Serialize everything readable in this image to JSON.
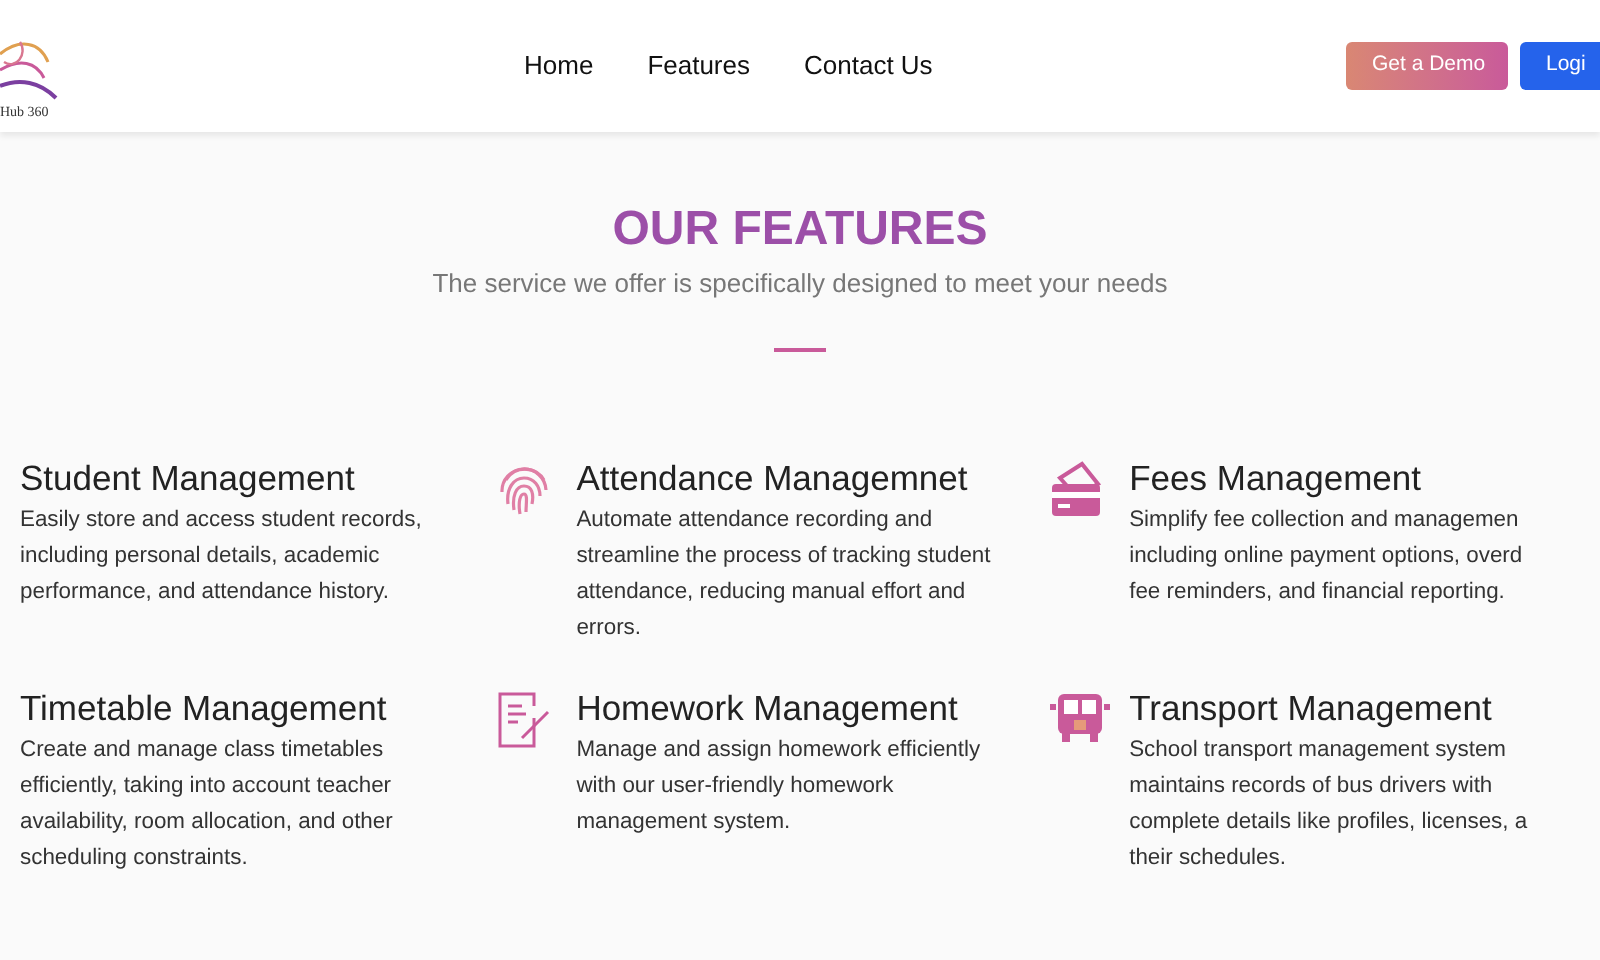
{
  "header": {
    "logo_text": "Hub 360",
    "nav": [
      {
        "label": "Home"
      },
      {
        "label": "Features"
      },
      {
        "label": "Contact Us"
      }
    ],
    "buttons": [
      {
        "label": "Get a Demo",
        "kind": "demo"
      },
      {
        "label": "Logi",
        "kind": "login"
      }
    ]
  },
  "section": {
    "title": "OUR FEATURES",
    "subtitle": "The service we offer is specifically designed to meet your needs"
  },
  "features": [
    {
      "title": "Student Management",
      "description": "Easily store and access student records,\nincluding personal details, academic\nperformance, and attendance history."
    },
    {
      "title": "Attendance Managemnet",
      "description": "Automate attendance recording and\nstreamline the process of tracking student\nattendance, reducing manual effort and\nerrors."
    },
    {
      "title": "Fees Management",
      "description": "Simplify fee collection and managemen\nincluding online payment options, overd\nfee reminders, and financial reporting."
    },
    {
      "title": "Timetable Management",
      "description": "Create and manage class timetables\nefficiently, taking into account teacher\navailability, room allocation, and other\nscheduling constraints."
    },
    {
      "title": "Homework Management",
      "description": "Manage and assign homework efficiently\nwith our user-friendly homework\nmanagement system."
    },
    {
      "title": "Transport Management",
      "description": "School transport management system\nmaintains records of bus drivers with\ncomplete details like profiles, licenses, a\ntheir schedules."
    }
  ]
}
